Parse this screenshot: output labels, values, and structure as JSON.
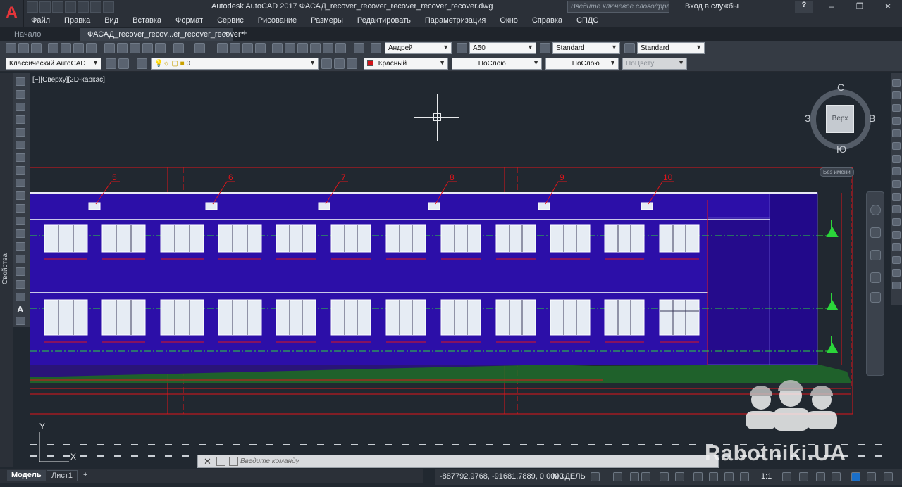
{
  "app": {
    "logo_letter": "A",
    "window_title": "Autodesk AutoCAD 2017   ФАСАД_recover_recover_recover_recover_recover.dwg",
    "search_placeholder": "Введите ключевое слово/фразу",
    "signin": "Вход в службы",
    "help": "?"
  },
  "menu": [
    "Файл",
    "Правка",
    "Вид",
    "Вставка",
    "Формат",
    "Сервис",
    "Рисование",
    "Размеры",
    "Редактировать",
    "Параметризация",
    "Окно",
    "Справка",
    "СПДС"
  ],
  "tabs": {
    "start": "Начало",
    "file": "ФАСАД_recover_recov...er_recover_recover*",
    "close": "×",
    "add": "+"
  },
  "toolbar1": {
    "text_style": "Андрей",
    "dim_style": "A50",
    "table_style": "Standard",
    "mleader_style": "Standard"
  },
  "toolbar2": {
    "workspace": "Классический AutoCAD",
    "layer": "0",
    "color": "Красный",
    "linetype": "ПоСлою",
    "lineweight": "ПоСлою",
    "plotstyle": "ПоЦвету",
    "swatch_color": "#d2141a"
  },
  "properties_label": "Свойства",
  "viewport": {
    "label": "[−][Сверху][2D-каркас]",
    "ucs_label": "Без имени",
    "viewcube": {
      "face": "Верх",
      "north": "С",
      "south": "Ю",
      "east": "В",
      "west": "З"
    },
    "ucs_axis_y": "Y",
    "ucs_axis_x": "X"
  },
  "drawing": {
    "window_numbers": [
      "5",
      "6",
      "7",
      "8",
      "9",
      "10"
    ],
    "facade_color": "#2c0fa8",
    "line_color": "#e0141a",
    "axis_color": "#2bd63a",
    "ground_color": "#1f6b2a"
  },
  "command": {
    "close": "✕",
    "placeholder": "Введите команду"
  },
  "layout_tabs": {
    "model": "Модель",
    "sheet": "Лист1",
    "add": "+"
  },
  "status": {
    "coords": "-887792.9768, -91681.7889, 0.0000",
    "mode": "МОДЕЛЬ",
    "scale": "1:1"
  },
  "watermark": "Rabotniki.UA"
}
